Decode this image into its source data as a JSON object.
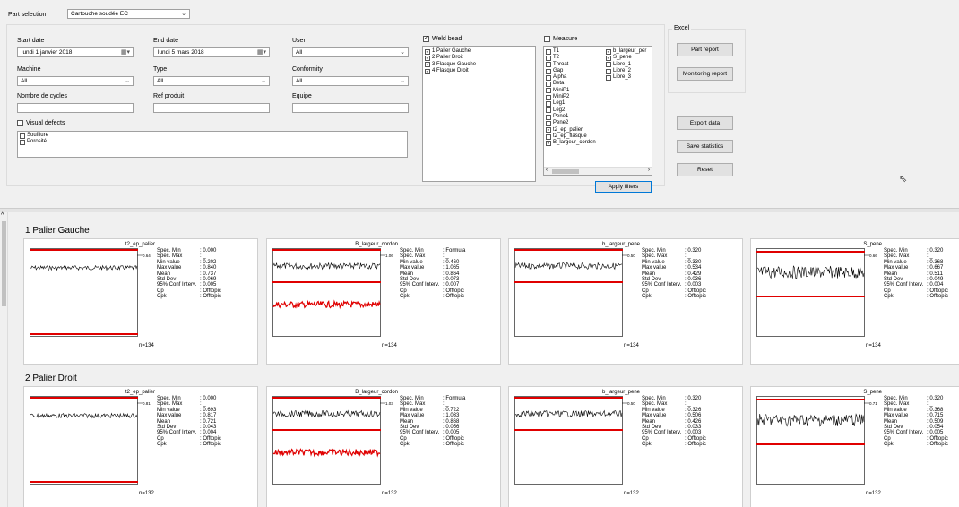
{
  "filters": {
    "part_selection_label": "Part selection",
    "part_selection_value": "Cartouche soudée EC",
    "start_date_label": "Start date",
    "start_date_value": "lundi    1  janvier   2018",
    "end_date_label": "End date",
    "end_date_value": "lundi    5   mars   2018",
    "user_label": "User",
    "user_value": "All",
    "machine_label": "Machine",
    "machine_value": "All",
    "type_label": "Type",
    "type_value": "All",
    "conformity_label": "Conformity",
    "conformity_value": "All",
    "cycles_label": "Nombre de cycles",
    "ref_label": "Ref produit",
    "equipe_label": "Equipe",
    "visual_defects_label": "Visual defects",
    "defects": [
      "Soufflure",
      "Porosité"
    ]
  },
  "weld_bead": {
    "label": "Weld bead",
    "items": [
      "1 Palier Gauche",
      "2 Palier Droit",
      "3 Flasque Gauche",
      "4 Flasque Droit"
    ]
  },
  "measure": {
    "label": "Measure",
    "col1": [
      {
        "label": "T1",
        "checked": false
      },
      {
        "label": "T2",
        "checked": false
      },
      {
        "label": "Throat",
        "checked": false
      },
      {
        "label": "Gap",
        "checked": false
      },
      {
        "label": "Alpha",
        "checked": false
      },
      {
        "label": "Beta",
        "checked": false
      },
      {
        "label": "MiniP1",
        "checked": false
      },
      {
        "label": "MiniP2",
        "checked": false
      },
      {
        "label": "Leg1",
        "checked": false
      },
      {
        "label": "Leg2",
        "checked": false
      },
      {
        "label": "Pene1",
        "checked": false
      },
      {
        "label": "Pene2",
        "checked": false
      },
      {
        "label": "t2_ep_palier",
        "checked": true
      },
      {
        "label": "t2_ep_flasque",
        "checked": false
      },
      {
        "label": "B_largeur_cordon",
        "checked": true
      }
    ],
    "col2": [
      {
        "label": "b_largeur_per",
        "checked": true
      },
      {
        "label": "S_pene",
        "checked": true
      },
      {
        "label": "Libre_1",
        "checked": false
      },
      {
        "label": "Libre_2",
        "checked": false
      },
      {
        "label": "Libre_3",
        "checked": false
      }
    ]
  },
  "excel": {
    "label": "Excel",
    "part_report": "Part report",
    "monitoring_report": "Monitoring report"
  },
  "actions": {
    "export": "Export data",
    "save_stats": "Save statistics",
    "reset": "Reset",
    "apply": "Apply filters"
  },
  "stat_labels": [
    "Spec. Min",
    "Spec. Max",
    "Min value",
    "Max value",
    "Mean",
    "Std Dev",
    "95% Conf Interv.",
    "Cp",
    "Cpk"
  ],
  "sections": [
    {
      "title": "1 Palier Gauche",
      "cards": [
        {
          "plot": "t2_ep_palier",
          "tag": "0.640",
          "n": "n=134",
          "values": [
            ": 0.000",
            ": _",
            ": 0.202",
            ": 0.840",
            ": 0.737",
            ": 0.069",
            ": 0.005",
            ": Offtopic",
            ": Offtopic"
          ]
        },
        {
          "plot": "B_largeur_cordon",
          "tag": "1.065",
          "n": "n=134",
          "values": [
            ": Formula",
            ": _",
            ": 0.460",
            ": 1.065",
            ": 0.864",
            ": 0.073",
            ": 0.007",
            ": Offtopic",
            ": Offtopic"
          ]
        },
        {
          "plot": "b_largeur_pene",
          "tag": "0.504",
          "n": "n=134",
          "values": [
            ": 0.320",
            ": _",
            ": 0.330",
            ": 0.534",
            ": 0.429",
            ": 0.036",
            ": 0.003",
            ": Offtopic",
            ": Offtopic"
          ]
        },
        {
          "plot": "S_pene",
          "tag": "0.667",
          "n": "n=134",
          "values": [
            ": 0.320",
            ": _",
            ": 0.368",
            ": 0.667",
            ": 0.511",
            ": 0.049",
            ": 0.004",
            ": Offtopic",
            ": Offtopic"
          ]
        }
      ]
    },
    {
      "title": "2 Palier Droit",
      "cards": [
        {
          "plot": "t2_ep_palier",
          "tag": "0.817",
          "n": "n=132",
          "values": [
            ": 0.000",
            ": _",
            ": 0.693",
            ": 0.817",
            ": 0.721",
            ": 0.043",
            ": 0.004",
            ": Offtopic",
            ": Offtopic"
          ]
        },
        {
          "plot": "B_largeur_cordon",
          "tag": "1.033",
          "n": "n=132",
          "values": [
            ": Formula",
            ": _",
            ": 0.722",
            ": 1.033",
            ": 0.868",
            ": 0.056",
            ": 0.005",
            ": Offtopic",
            ": Offtopic"
          ]
        },
        {
          "plot": "b_largeur_pene",
          "tag": "0.505",
          "n": "n=132",
          "values": [
            ": 0.320",
            ": _",
            ": 0.326",
            ": 0.506",
            ": 0.426",
            ": 0.033",
            ": 0.003",
            ": Offtopic",
            ": Offtopic"
          ]
        },
        {
          "plot": "S_pene",
          "tag": "0.716",
          "n": "n=132",
          "values": [
            ": 0.320",
            ": _",
            ": 0.368",
            ": 0.715",
            ": 0.509",
            ": 0.054",
            ": 0.005",
            ": Offtopic",
            ": Offtopic"
          ]
        }
      ]
    }
  ],
  "colors": {
    "spec_line": "#e00000",
    "trace": "#000000",
    "red_trace": "#e00000"
  }
}
